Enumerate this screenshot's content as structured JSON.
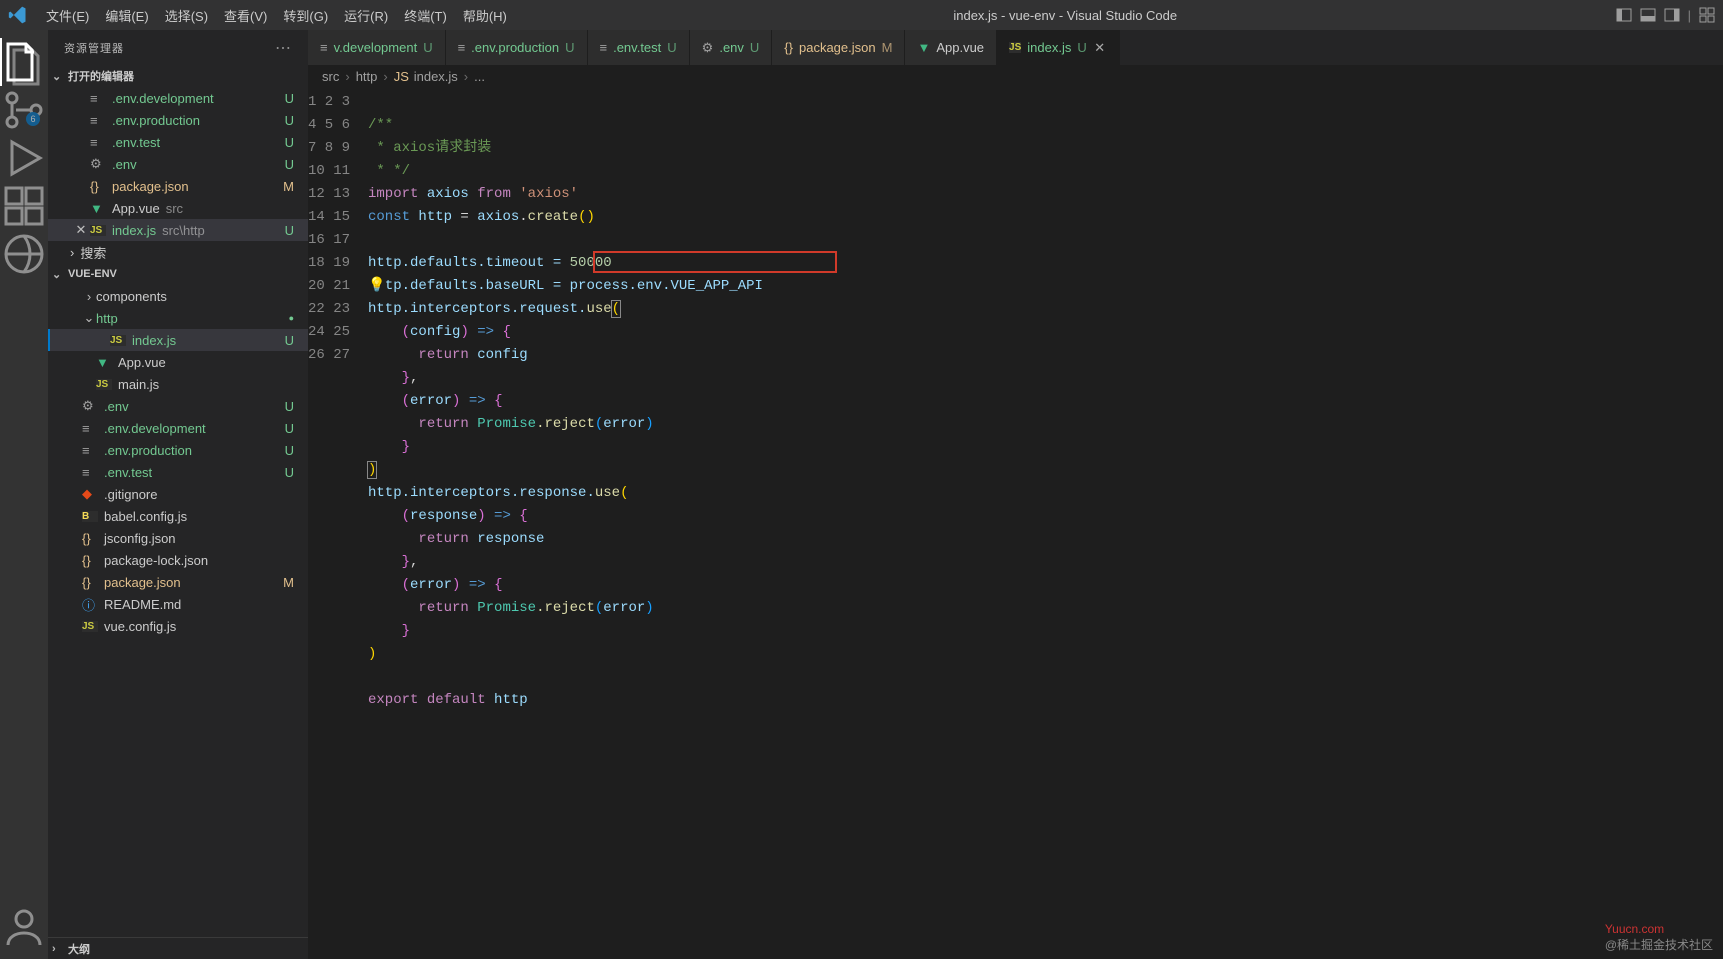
{
  "window": {
    "title": "index.js - vue-env - Visual Studio Code"
  },
  "menu": [
    "文件(E)",
    "编辑(E)",
    "选择(S)",
    "查看(V)",
    "转到(G)",
    "运行(R)",
    "终端(T)",
    "帮助(H)"
  ],
  "activity_badge": "6",
  "sidebar": {
    "title": "资源管理器",
    "open_editors_label": "打开的编辑器",
    "search_label": "搜索",
    "open_editors": [
      {
        "icon": "env",
        "name": ".env.development",
        "status": "U",
        "status_type": "u"
      },
      {
        "icon": "env",
        "name": ".env.production",
        "status": "U",
        "status_type": "u"
      },
      {
        "icon": "env",
        "name": ".env.test",
        "status": "U",
        "status_type": "u"
      },
      {
        "icon": "gear",
        "name": ".env",
        "status": "U",
        "status_type": "u"
      },
      {
        "icon": "json",
        "name": "package.json",
        "status": "M",
        "status_type": "m"
      },
      {
        "icon": "vue",
        "name": "App.vue",
        "path": "src",
        "status": "",
        "status_type": ""
      },
      {
        "icon": "js",
        "name": "index.js",
        "path": "src\\http",
        "status": "U",
        "status_type": "u",
        "active": true
      }
    ],
    "project_name": "VUE-ENV",
    "tree": [
      {
        "indent": 1,
        "chev": "›",
        "icon": "",
        "name": "components",
        "green": false
      },
      {
        "indent": 1,
        "chev": "⌄",
        "icon": "",
        "name": "http",
        "green": true,
        "dot": true
      },
      {
        "indent": 2,
        "chev": "",
        "icon": "js",
        "name": "index.js",
        "green": true,
        "status": "U",
        "selected": true
      },
      {
        "indent": 1,
        "chev": "",
        "icon": "vue",
        "name": "App.vue"
      },
      {
        "indent": 1,
        "chev": "",
        "icon": "js",
        "name": "main.js"
      },
      {
        "indent": 0,
        "chev": "",
        "icon": "gear",
        "name": ".env",
        "green": true,
        "status": "U"
      },
      {
        "indent": 0,
        "chev": "",
        "icon": "env",
        "name": ".env.development",
        "green": true,
        "status": "U"
      },
      {
        "indent": 0,
        "chev": "",
        "icon": "env",
        "name": ".env.production",
        "green": true,
        "status": "U"
      },
      {
        "indent": 0,
        "chev": "",
        "icon": "env",
        "name": ".env.test",
        "green": true,
        "status": "U"
      },
      {
        "indent": 0,
        "chev": "",
        "icon": "git",
        "name": ".gitignore"
      },
      {
        "indent": 0,
        "chev": "",
        "icon": "babel",
        "name": "babel.config.js"
      },
      {
        "indent": 0,
        "chev": "",
        "icon": "json",
        "name": "jsconfig.json"
      },
      {
        "indent": 0,
        "chev": "",
        "icon": "json",
        "name": "package-lock.json"
      },
      {
        "indent": 0,
        "chev": "",
        "icon": "json",
        "name": "package.json",
        "mod": true,
        "status": "M"
      },
      {
        "indent": 0,
        "chev": "",
        "icon": "readme",
        "name": "README.md"
      },
      {
        "indent": 0,
        "chev": "",
        "icon": "js",
        "name": "vue.config.js"
      }
    ],
    "outline_label": "大纲"
  },
  "tabs": [
    {
      "icon": "env",
      "label": "v.development",
      "status": "U",
      "status_type": "u"
    },
    {
      "icon": "env",
      "label": ".env.production",
      "status": "U",
      "status_type": "u"
    },
    {
      "icon": "env",
      "label": ".env.test",
      "status": "U",
      "status_type": "u"
    },
    {
      "icon": "gear",
      "label": ".env",
      "status": "U",
      "status_type": "u"
    },
    {
      "icon": "json",
      "label": "package.json",
      "status": "M",
      "status_type": "m"
    },
    {
      "icon": "vue",
      "label": "App.vue",
      "status": "",
      "status_type": ""
    },
    {
      "icon": "js",
      "label": "index.js",
      "status": "U",
      "status_type": "u",
      "active": true,
      "close": true
    }
  ],
  "breadcrumb": {
    "p0": "src",
    "p1": "http",
    "p2": "index.js",
    "p3": "..."
  },
  "code": {
    "lines": 27,
    "l1": "/**",
    "l2": " * axios请求封装",
    "l3": " * */",
    "l4_import": "import",
    "l4_axios": "axios",
    "l4_from": "from",
    "l4_str": "'axios'",
    "l5_const": "const",
    "l5_http": "http",
    "l5_eq": " = ",
    "l5_axios": "axios",
    "l5_dot": ".",
    "l5_create": "create",
    "l7_http": "http",
    "l7_mid": ".defaults.timeout = ",
    "l7_num": "50000",
    "l8_pre": "tp",
    "l8_mid": ".defaults.baseURL = ",
    "l8_process": "process",
    "l8_env": ".env.",
    "l8_api": "VUE_APP_API",
    "l9_http": "http",
    "l9_mid": ".interceptors.request.",
    "l9_use": "use",
    "l10_cfg": "config",
    "l11_ret": "return",
    "l11_cfg": "config",
    "l13_err": "error",
    "l14_ret": "return",
    "l14_promise": "Promise",
    "l14_reject": ".reject",
    "l14_err": "error",
    "l17_http": "http",
    "l17_mid": ".interceptors.response.",
    "l17_use": "use",
    "l18_resp": "response",
    "l19_ret": "return",
    "l19_resp": "response",
    "l21_err": "error",
    "l22_ret": "return",
    "l22_promise": "Promise",
    "l22_reject": ".reject",
    "l22_err": "error",
    "l26_export": "export",
    "l26_default": "default",
    "l26_http": "http"
  },
  "watermark": {
    "brand": "Yuucn.com",
    "sub": "@稀土掘金技术社区"
  }
}
